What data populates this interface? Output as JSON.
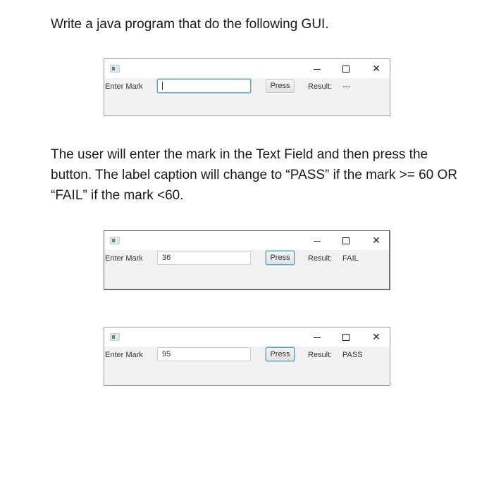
{
  "document": {
    "heading": "Write a java program that do the following GUI.",
    "paragraph": "The user will enter the mark in the Text Field and then press the button. The label caption will change to “PASS” if the mark >= 60 OR “FAIL” if the mark <60."
  },
  "windows": [
    {
      "controls": {
        "minimize": "minimize",
        "maximize": "maximize",
        "close": "✕"
      },
      "enter_label": "Enter Mark",
      "mark_value": "",
      "button_label": "Press",
      "result_label": "Result:",
      "result_value": "---"
    },
    {
      "controls": {
        "minimize": "minimize",
        "maximize": "maximize",
        "close": "✕"
      },
      "enter_label": "Enter Mark",
      "mark_value": "36",
      "button_label": "Press",
      "result_label": "Result:",
      "result_value": "FAIL"
    },
    {
      "controls": {
        "minimize": "minimize",
        "maximize": "maximize",
        "close": "✕"
      },
      "enter_label": "Enter Mark",
      "mark_value": "95",
      "button_label": "Press",
      "result_label": "Result:",
      "result_value": "PASS"
    }
  ]
}
